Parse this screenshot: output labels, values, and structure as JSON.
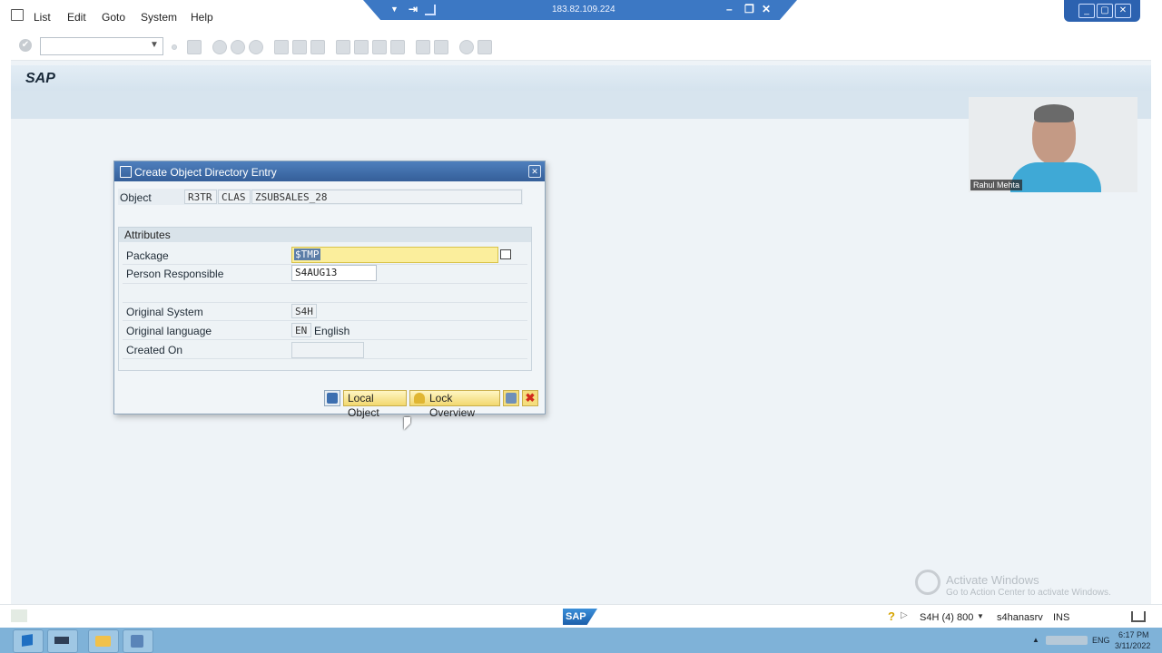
{
  "menu": {
    "items": [
      "List",
      "Edit",
      "Goto",
      "System",
      "Help"
    ]
  },
  "rdp": {
    "ip": "183.82.109.224"
  },
  "header": {
    "title": "SAP"
  },
  "dialog": {
    "title": "Create Object Directory Entry",
    "object_label": "Object",
    "object_pgmid": "R3TR",
    "object_type": "CLAS",
    "object_name": "ZSUBSALES_28",
    "attributes_title": "Attributes",
    "package_label": "Package",
    "package_value": "$TMP",
    "person_label": "Person Responsible",
    "person_value": "S4AUG13",
    "orig_system_label": "Original System",
    "orig_system_value": "S4H",
    "orig_lang_label": "Original language",
    "orig_lang_code": "EN",
    "orig_lang_name": "English",
    "created_label": "Created On",
    "created_value": "",
    "btn_local": "Local Object",
    "btn_lock": "Lock Overview"
  },
  "webcam": {
    "name": "Rahul Mehta"
  },
  "watermark": {
    "title": "Activate Windows",
    "subtitle": "Go to Action Center to activate Windows."
  },
  "status": {
    "system": "S4H (4) 800",
    "server": "s4hanasrv",
    "mode": "INS"
  },
  "taskbar": {
    "lang": "ENG",
    "time": "6:17 PM",
    "date": "3/11/2022"
  }
}
